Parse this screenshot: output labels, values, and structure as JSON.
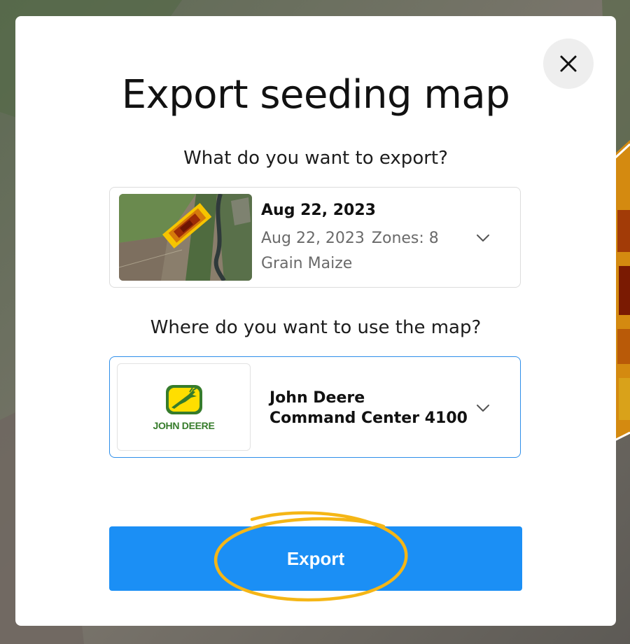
{
  "colors": {
    "accent": "#1b8ff5",
    "selected_border": "#2e8eea",
    "highlight": "#f5b616",
    "john_deere_green": "#367c2b",
    "john_deere_yellow": "#ffde00"
  },
  "modal": {
    "title": "Export seeding map",
    "close_icon": "close-icon"
  },
  "export_source": {
    "question": "What do you want to export?",
    "selected": {
      "title": "Aug 22, 2023",
      "date": "Aug 22, 2023",
      "zones": "Zones: 8",
      "crop": "Grain Maize"
    },
    "chevron_icon": "chevron-down-icon"
  },
  "export_target": {
    "question": "Where do you want to use the map?",
    "logo_text": "JOHN DEERE",
    "device_line1": "John Deere",
    "device_line2": "Command Center 4100",
    "chevron_icon": "chevron-down-icon"
  },
  "actions": {
    "export_label": "Export"
  }
}
